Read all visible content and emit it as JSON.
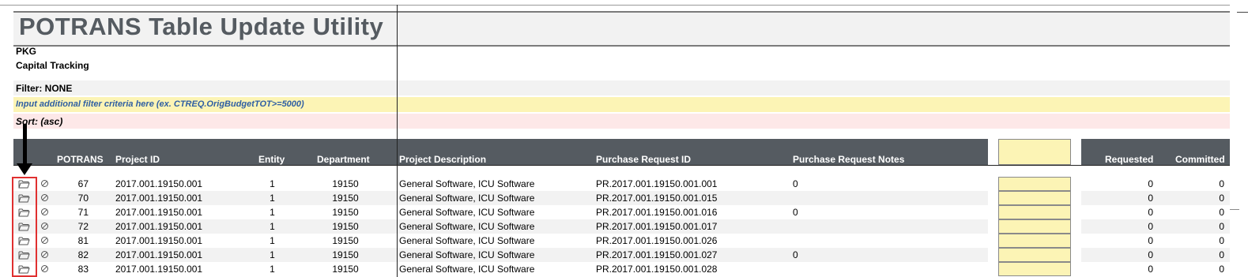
{
  "title": "POTRANS Table Update Utility",
  "pkg": "PKG",
  "module": "Capital Tracking",
  "filter_label": "Filter: NONE",
  "filter_input_prompt": "Input additional filter criteria here (ex. CTREQ.OrigBudgetTOT>=5000)",
  "sort_label": "Sort:  (asc)",
  "columns": {
    "potrans": "POTRANS",
    "project_id": "Project ID",
    "entity": "Entity",
    "department": "Department",
    "description": "Project Description",
    "pr_id": "Purchase Request ID",
    "pr_notes": "Purchase Request Notes",
    "requested": "Requested",
    "committed": "Committed"
  },
  "rows": [
    {
      "potrans": "67",
      "project_id": "2017.001.19150.001",
      "entity": "1",
      "department": "19150",
      "description": "General Software, ICU Software",
      "pr_id": "PR.2017.001.19150.001.001",
      "notes": "0",
      "requested": "0",
      "committed": "0"
    },
    {
      "potrans": "70",
      "project_id": "2017.001.19150.001",
      "entity": "1",
      "department": "19150",
      "description": "General Software, ICU Software",
      "pr_id": "PR.2017.001.19150.001.015",
      "notes": "",
      "requested": "0",
      "committed": "0"
    },
    {
      "potrans": "71",
      "project_id": "2017.001.19150.001",
      "entity": "1",
      "department": "19150",
      "description": "General Software, ICU Software",
      "pr_id": "PR.2017.001.19150.001.016",
      "notes": "0",
      "requested": "0",
      "committed": "0"
    },
    {
      "potrans": "72",
      "project_id": "2017.001.19150.001",
      "entity": "1",
      "department": "19150",
      "description": "General Software, ICU Software",
      "pr_id": "PR.2017.001.19150.001.017",
      "notes": "",
      "requested": "0",
      "committed": "0"
    },
    {
      "potrans": "81",
      "project_id": "2017.001.19150.001",
      "entity": "1",
      "department": "19150",
      "description": "General Software, ICU Software",
      "pr_id": "PR.2017.001.19150.001.026",
      "notes": "",
      "requested": "0",
      "committed": "0"
    },
    {
      "potrans": "82",
      "project_id": "2017.001.19150.001",
      "entity": "1",
      "department": "19150",
      "description": "General Software, ICU Software",
      "pr_id": "PR.2017.001.19150.001.027",
      "notes": "0",
      "requested": "0",
      "committed": "0"
    },
    {
      "potrans": "83",
      "project_id": "2017.001.19150.001",
      "entity": "1",
      "department": "19150",
      "description": "General Software, ICU Software",
      "pr_id": "PR.2017.001.19150.001.028",
      "notes": "",
      "requested": "0",
      "committed": "0"
    }
  ],
  "colors": {
    "header_bg": "#555b61",
    "input_band": "#fcf4b5",
    "sort_band": "#fde8e8",
    "highlight": "#e03030"
  },
  "icons": {
    "open_record": "folder-open-icon",
    "block": "no-entry-icon",
    "annotation": "down-arrow-icon"
  }
}
